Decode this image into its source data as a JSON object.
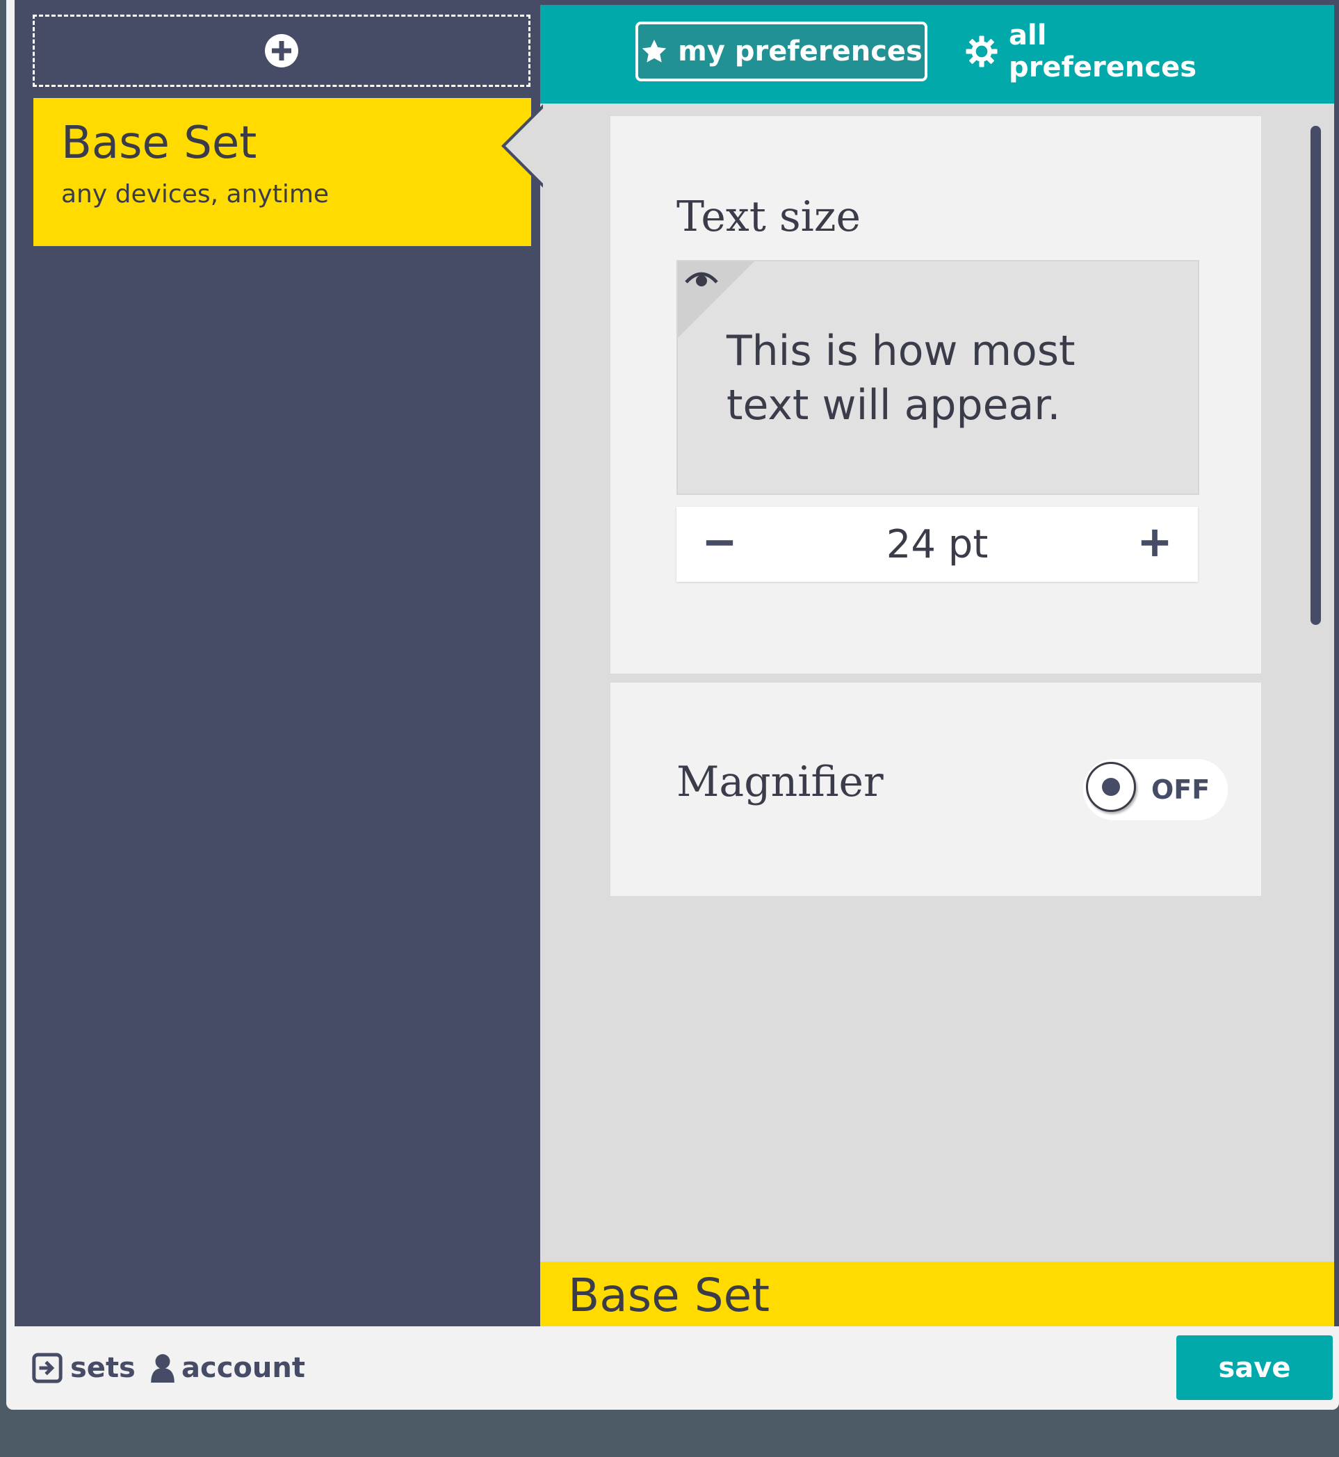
{
  "sidebar": {
    "add_icon": "plus-circle-icon",
    "set": {
      "name": "Base Set",
      "subtitle": "any devices, anytime"
    }
  },
  "tabs": [
    {
      "label": "my preferences",
      "icon": "star-icon",
      "active": true
    },
    {
      "label": "all preferences",
      "icon": "gear-icon",
      "active": false
    }
  ],
  "text_size": {
    "title": "Text size",
    "preview_icon": "eye-icon",
    "preview_text": "This is how most text will appear.",
    "value": "24 pt",
    "decrease_icon": "minus-icon",
    "increase_icon": "plus-icon"
  },
  "magnifier": {
    "title": "Magnifier",
    "state_label": "OFF",
    "on": false
  },
  "footer_set": {
    "name": "Base Set"
  },
  "bottom_bar": {
    "sets_label": "sets",
    "sets_icon": "sign-in-icon",
    "account_label": "account",
    "account_icon": "user-icon",
    "save_label": "save"
  },
  "colors": {
    "teal": "#01a9aa",
    "dark_slate": "#474c66",
    "yellow": "#ffdb00",
    "panel_bg": "#dcdcdc"
  }
}
